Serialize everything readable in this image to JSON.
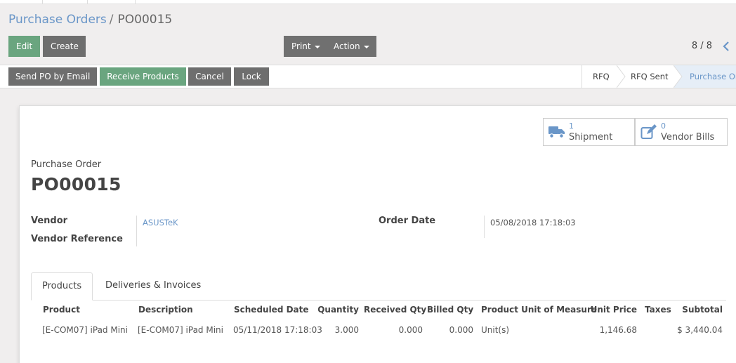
{
  "breadcrumb": {
    "parent": "Purchase Orders",
    "separator": "/",
    "current": "PO00015"
  },
  "toolbar": {
    "edit": "Edit",
    "create": "Create",
    "print": "Print",
    "action": "Action"
  },
  "pager": {
    "text": "8 / 8"
  },
  "header_buttons": {
    "send_email": "Send PO by Email",
    "receive": "Receive Products",
    "cancel": "Cancel",
    "lock": "Lock"
  },
  "stages": [
    "RFQ",
    "RFQ Sent",
    "Purchase Order"
  ],
  "smart_buttons": {
    "shipment": {
      "value": "1",
      "label": "Shipment",
      "icon": "truck-icon"
    },
    "bills": {
      "value": "0",
      "label": "Vendor Bills",
      "icon": "edit-icon"
    }
  },
  "form": {
    "doc_label": "Purchase Order",
    "doc_name": "PO00015",
    "vendor_label": "Vendor",
    "vendor_value": "ASUSTeK",
    "vendor_ref_label": "Vendor Reference",
    "order_date_label": "Order Date",
    "order_date_value": "05/08/2018 17:18:03"
  },
  "tabs": [
    "Products",
    "Deliveries & Invoices"
  ],
  "table": {
    "columns": [
      "Product",
      "Description",
      "Scheduled Date",
      "Quantity",
      "Received Qty",
      "Billed Qty",
      "Product Unit of Measure",
      "Unit Price",
      "Taxes",
      "Subtotal"
    ],
    "rows": [
      [
        "[E-COM07] iPad Mini",
        "[E-COM07] iPad Mini",
        "05/11/2018 17:18:03",
        "3.000",
        "0.000",
        "0.000",
        "Unit(s)",
        "1,146.68",
        "",
        "$ 3,440.04"
      ]
    ]
  },
  "colors": {
    "primary_green": "#6aa57f",
    "link_blue": "#6a96c8",
    "button_grey": "#6e6e6e"
  }
}
